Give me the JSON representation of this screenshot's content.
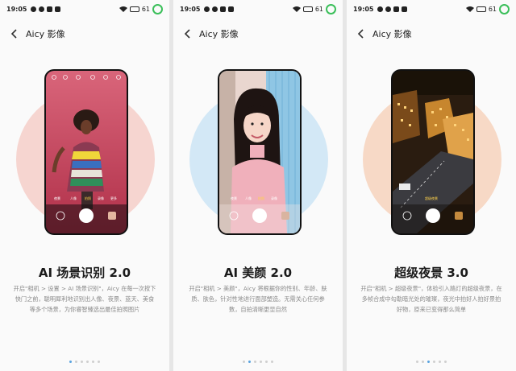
{
  "status_bar": {
    "time": "19:05",
    "battery": "61"
  },
  "nav": {
    "title": "Aicy 影像"
  },
  "accents": {
    "dot_active": "#5aa3e0",
    "battery_ring": "#3bbf5a"
  },
  "slides": [
    {
      "title": "AI 场景识别 2.0",
      "desc": "开启\"相机 > 设置 > AI 场景识别\"，Aicy 在每一次按下快门之前，聪明犀利地识别出人像、夜景、蓝天、美食等多个场景，为你睿智臻选出最佳拍照图片",
      "halo_color": "#f6d5d0",
      "mode_labels": [
        "夜景",
        "人像",
        "拍照",
        "录像",
        "更多"
      ]
    },
    {
      "title": "AI 美颜 2.0",
      "desc": "开启\"相机 > 美颜\"，Aicy 将根据你的性别、年龄、肤质、肤色，针对性地进行面部塑造。无需关心任何参数，自拍清晰更显自然",
      "halo_color": "#d3e8f6",
      "mode_labels": [
        "夜景",
        "人像",
        "拍照",
        "录像"
      ]
    },
    {
      "title": "超级夜景 3.0",
      "desc": "开启\"相机 > 超级夜景\"，体验引入路灯的超级夜景，在多帧合成中勾勒暗光处的璀璨，夜光中拍好人拍好景拍好物，原来已变得那么简单",
      "halo_color": "#f7d9c6",
      "mode_labels": [
        "超级夜景"
      ]
    }
  ]
}
